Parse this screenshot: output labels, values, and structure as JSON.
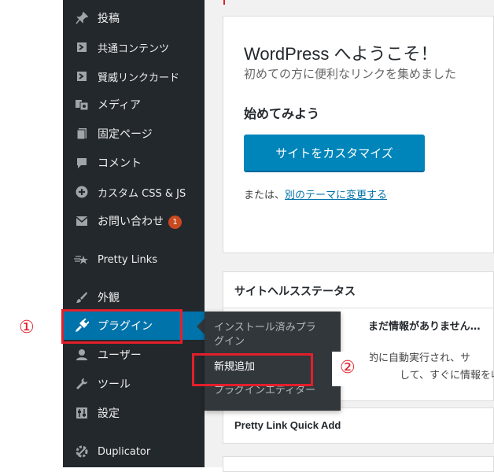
{
  "sidebar": {
    "items": [
      {
        "label": "投稿",
        "icon": "pin-icon"
      },
      {
        "label": "共通コンテンツ",
        "icon": "block-icon"
      },
      {
        "label": "賢威リンクカード",
        "icon": "block-icon"
      },
      {
        "label": "メディア",
        "icon": "media-icon"
      },
      {
        "label": "固定ページ",
        "icon": "page-icon"
      },
      {
        "label": "コメント",
        "icon": "comment-icon"
      },
      {
        "label": "カスタム CSS & JS",
        "icon": "plus-icon"
      },
      {
        "label": "お問い合わせ",
        "icon": "mail-icon",
        "badge": "1"
      },
      {
        "label": "Pretty Links",
        "icon": "star-icon"
      },
      {
        "label": "外観",
        "icon": "brush-icon"
      },
      {
        "label": "プラグイン",
        "icon": "plugin-icon"
      },
      {
        "label": "ユーザー",
        "icon": "user-icon"
      },
      {
        "label": "ツール",
        "icon": "wrench-icon"
      },
      {
        "label": "設定",
        "icon": "settings-icon"
      },
      {
        "label": "Duplicator",
        "icon": "duplicator-icon"
      }
    ]
  },
  "flyout": {
    "installed_line1": "インストール済みプラ",
    "installed_line2": "グイン",
    "add_new": "新規追加",
    "editor": "プラグインエディター"
  },
  "annotations": {
    "one": "①",
    "two": "②"
  },
  "welcome": {
    "title": "WordPress へようこそ！",
    "subtitle": "初めての方に便利なリンクを集めました",
    "start": "始めてみよう",
    "customize_button": "サイトをカスタマイズ",
    "or_text": "または、",
    "theme_link": "別のテーマに変更する"
  },
  "health": {
    "title": "サイトヘルスステータス",
    "no_data": "まだ情報がありません…",
    "line1": "的に自動実行され、サ",
    "line2": "して、すぐに情報を収"
  },
  "quickadd": {
    "title": "Pretty Link Quick Add"
  },
  "colors": {
    "sidebar_bg": "#23282d",
    "active_bg": "#0073aa",
    "button_bg": "#0085ba",
    "highlight_red": "#e21f2a",
    "badge": "#ca4a1f"
  }
}
